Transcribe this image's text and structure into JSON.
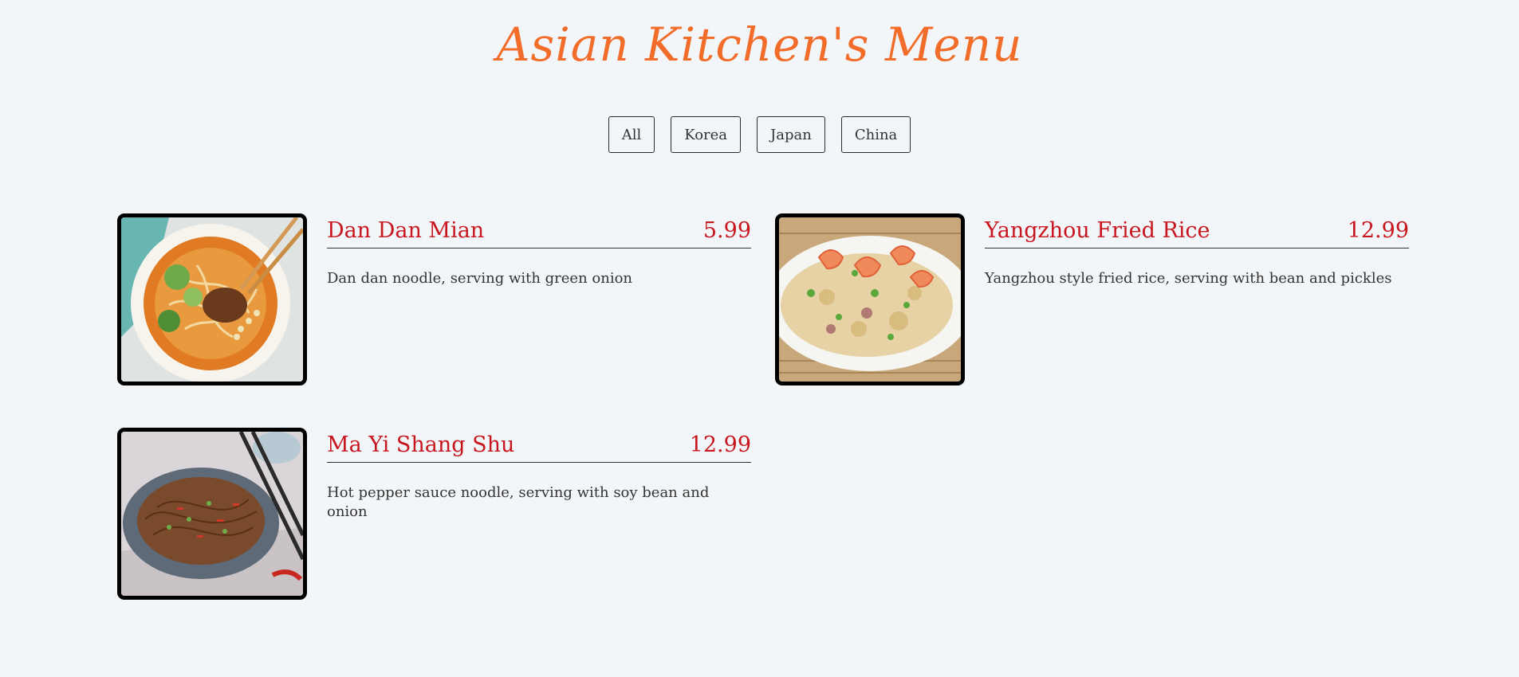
{
  "header": {
    "title": "Asian Kitchen's Menu"
  },
  "filters": [
    {
      "label": "All"
    },
    {
      "label": "Korea"
    },
    {
      "label": "Japan"
    },
    {
      "label": "China"
    }
  ],
  "menu": [
    {
      "name": "Dan Dan Mian",
      "price": "5.99",
      "desc": "Dan dan noodle, serving with green onion",
      "image_icon": "noodle-bowl-photo"
    },
    {
      "name": "Yangzhou Fried Rice",
      "price": "12.99",
      "desc": "Yangzhou style fried rice, serving with bean and pickles",
      "image_icon": "fried-rice-photo"
    },
    {
      "name": "Ma Yi Shang Shu",
      "price": "12.99",
      "desc": "Hot pepper sauce noodle, serving with soy bean and onion",
      "image_icon": "glass-noodle-photo"
    }
  ],
  "colors": {
    "background": "#f3f6f9",
    "title": "#f26c2a",
    "accent": "#c8161e",
    "text": "#333333"
  }
}
